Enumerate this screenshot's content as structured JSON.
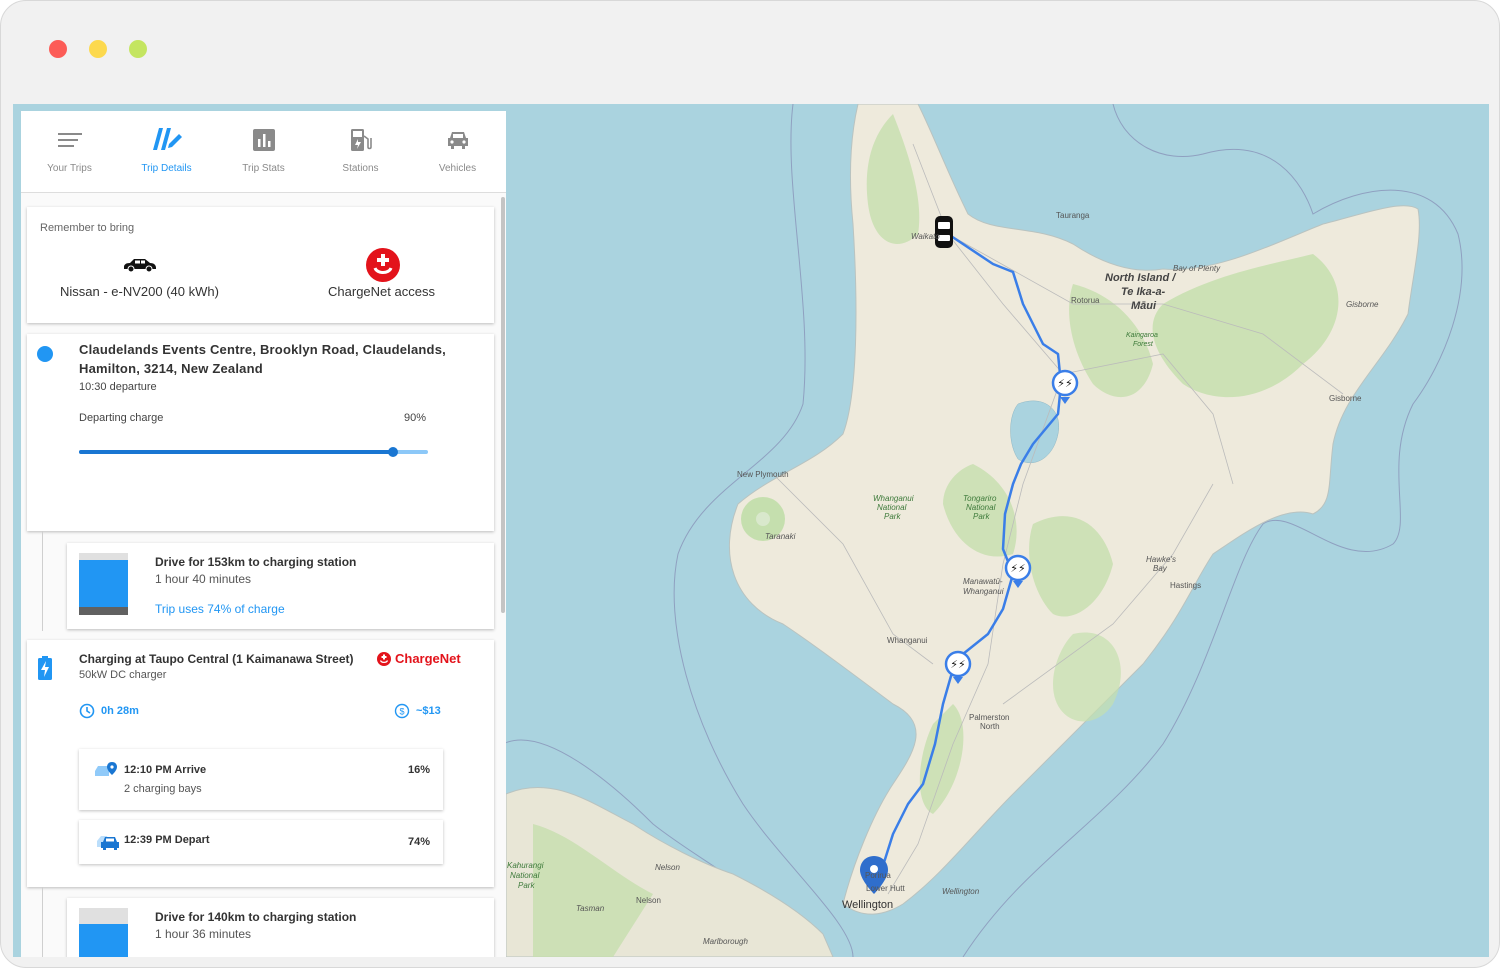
{
  "tabs": [
    {
      "label": "Your Trips",
      "icon": "list-icon"
    },
    {
      "label": "Trip Details",
      "icon": "route-icon"
    },
    {
      "label": "Trip Stats",
      "icon": "bar-chart-icon"
    },
    {
      "label": "Stations",
      "icon": "ev-station-icon"
    },
    {
      "label": "Vehicles",
      "icon": "car-icon"
    }
  ],
  "bring": {
    "title": "Remember to bring",
    "vehicle": "Nissan - e-NV200 (40 kWh)",
    "access": "ChargeNet access"
  },
  "origin": {
    "address": "Claudelands Events Centre, Brooklyn Road, Claudelands, Hamilton, 3214, New Zealand",
    "departure": "10:30 departure",
    "charge_label": "Departing charge",
    "charge_value": "90%",
    "charge_fraction": 0.9
  },
  "legs": [
    {
      "title": "Drive for 153km to charging station",
      "duration": "1 hour 40 minutes",
      "usage": "Trip uses 74% of charge"
    },
    {
      "title": "Drive for 140km to charging station",
      "duration": "1 hour 36 minutes"
    }
  ],
  "charging": {
    "title": "Charging at Taupo Central (1 Kaimanawa Street)",
    "charger": "50kW DC charger",
    "network": "ChargeNet",
    "time": "0h 28m",
    "cost": "~$13",
    "arrive": {
      "time": "12:10 PM Arrive",
      "bays": "2 charging bays",
      "percent": "16%"
    },
    "depart": {
      "time": "12:39 PM Depart",
      "percent": "74%"
    }
  },
  "map": {
    "labels": {
      "tauranga": "Tauranga",
      "waikato": "Waikato",
      "bay_of_plenty": "Bay of Plenty",
      "north_island": "North Island /",
      "te_ika": "Te Ika-a-",
      "maui": "Māui",
      "rotorua": "Rotorua",
      "kaingaroa": "Kaingaroa",
      "forest": "Forest",
      "gisborne_upper": "Gisborne",
      "gisborne": "Gisborne",
      "new_plymouth": "New Plymouth",
      "whanganui_np1": "Whanganui",
      "whanganui_np2": "National",
      "whanganui_np3": "Park",
      "tongariro1": "Tongariro",
      "tongariro2": "National",
      "tongariro3": "Park",
      "taranaki": "Taranaki",
      "hawkes1": "Hawke's",
      "hawkes2": "Bay",
      "hastings": "Hastings",
      "manawatu1": "Manawatū-",
      "manawatu2": "Whanganui",
      "whanganui": "Whanganui",
      "palmerston1": "Palmerston",
      "palmerston2": "North",
      "kahurangi1": "Kahurangi",
      "kahurangi2": "National",
      "kahurangi3": "Park",
      "nelson_upper": "Nelson",
      "nelson": "Nelson",
      "tasman": "Tasman",
      "lower_hutt": "Lower Hutt",
      "wellington": "Wellington",
      "wellington_region": "Wellington",
      "marlborough": "Marlborough",
      "porirua": "Porirua"
    },
    "colors": {
      "route": "#3a7ee8",
      "water": "#aad3df",
      "land": "#eeeadc",
      "forest": "#c5dfae"
    }
  }
}
